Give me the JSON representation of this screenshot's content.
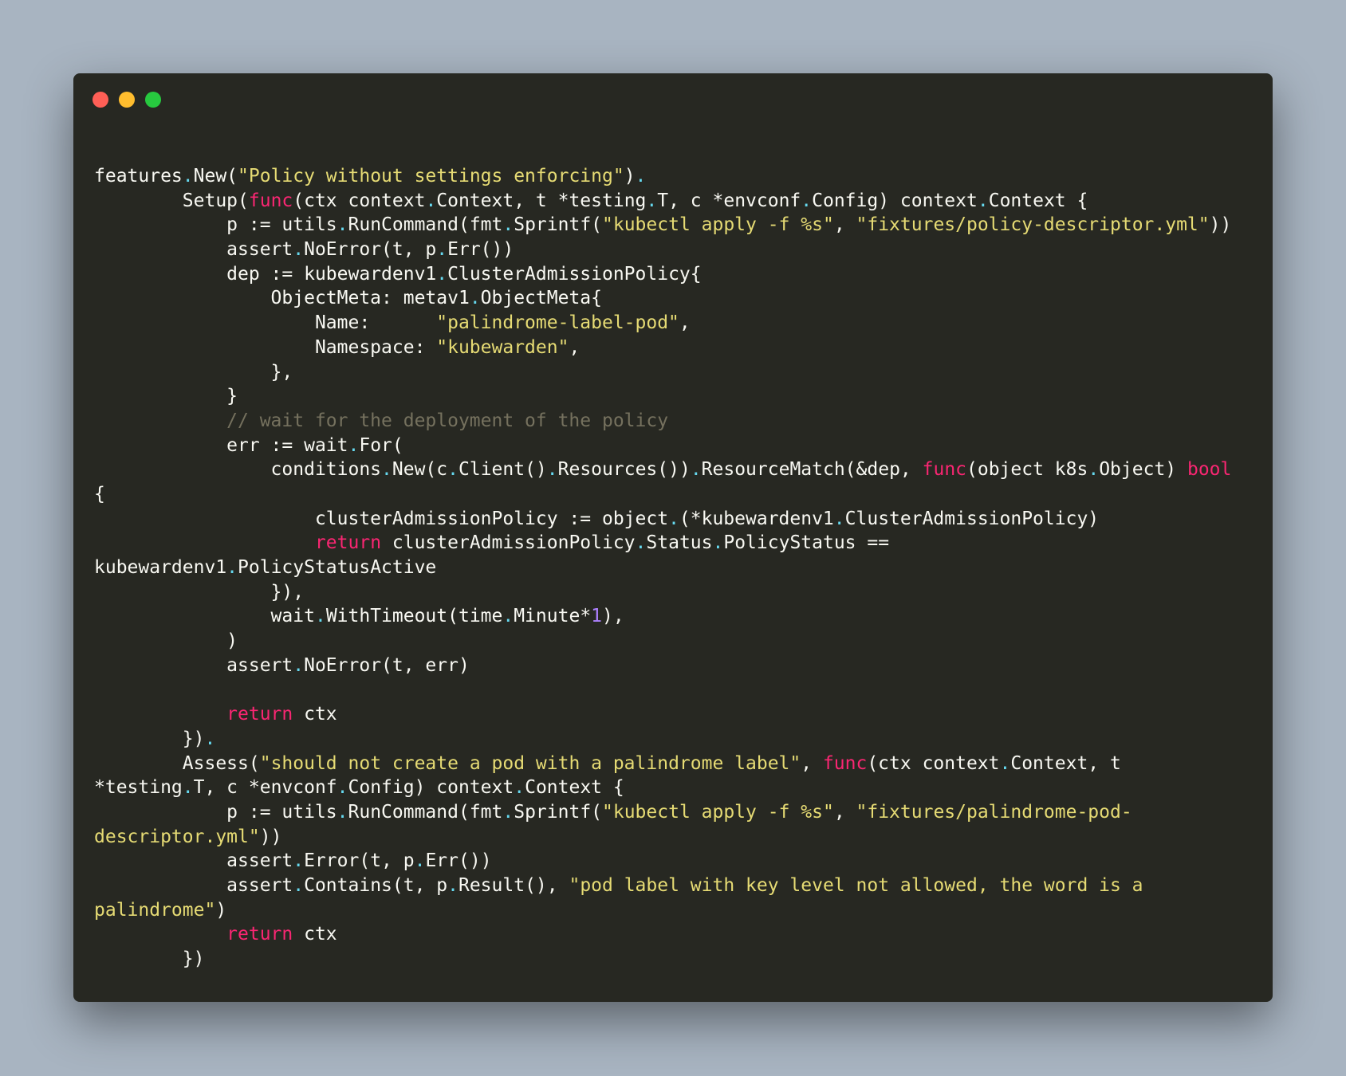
{
  "window": {
    "buttons": [
      "close",
      "minimize",
      "maximize"
    ],
    "colors": {
      "background": "#a8b4c1",
      "editor": "#272822",
      "close": "#ff5f56",
      "minimize": "#ffbd2e",
      "maximize": "#27c93f",
      "plain": "#f8f8f2",
      "punctuation_dot": "#66d9ef",
      "string": "#e6db74",
      "keyword": "#f92672",
      "comment": "#75715e",
      "number": "#ae81ff"
    }
  },
  "code": {
    "lines": [
      [
        [
          "plain",
          "features"
        ],
        [
          "dot",
          "."
        ],
        [
          "plain",
          "New("
        ],
        [
          "str",
          "\"Policy without settings enforcing\""
        ],
        [
          "plain",
          ")"
        ],
        [
          "dot",
          "."
        ]
      ],
      [
        [
          "plain",
          "        Setup("
        ],
        [
          "kw",
          "func"
        ],
        [
          "plain",
          "(ctx context"
        ],
        [
          "dot",
          "."
        ],
        [
          "plain",
          "Context, t *testing"
        ],
        [
          "dot",
          "."
        ],
        [
          "plain",
          "T, c *envconf"
        ],
        [
          "dot",
          "."
        ],
        [
          "plain",
          "Config) context"
        ],
        [
          "dot",
          "."
        ],
        [
          "plain",
          "Context {"
        ]
      ],
      [
        [
          "plain",
          "            p := utils"
        ],
        [
          "dot",
          "."
        ],
        [
          "plain",
          "RunCommand(fmt"
        ],
        [
          "dot",
          "."
        ],
        [
          "plain",
          "Sprintf("
        ],
        [
          "str",
          "\"kubectl apply -f %s\""
        ],
        [
          "plain",
          ", "
        ],
        [
          "str",
          "\"fixtures/policy-descriptor.yml\""
        ],
        [
          "plain",
          "))"
        ]
      ],
      [
        [
          "plain",
          "            assert"
        ],
        [
          "dot",
          "."
        ],
        [
          "plain",
          "NoError(t, p"
        ],
        [
          "dot",
          "."
        ],
        [
          "plain",
          "Err())"
        ]
      ],
      [
        [
          "plain",
          "            dep := kubewardenv1"
        ],
        [
          "dot",
          "."
        ],
        [
          "plain",
          "ClusterAdmissionPolicy{"
        ]
      ],
      [
        [
          "plain",
          "                ObjectMeta: metav1"
        ],
        [
          "dot",
          "."
        ],
        [
          "plain",
          "ObjectMeta{"
        ]
      ],
      [
        [
          "plain",
          "                    Name:      "
        ],
        [
          "str",
          "\"palindrome-label-pod\""
        ],
        [
          "plain",
          ","
        ]
      ],
      [
        [
          "plain",
          "                    Namespace: "
        ],
        [
          "str",
          "\"kubewarden\""
        ],
        [
          "plain",
          ","
        ]
      ],
      [
        [
          "plain",
          "                },"
        ]
      ],
      [
        [
          "plain",
          "            }"
        ]
      ],
      [
        [
          "cmt",
          "            // wait for the deployment of the policy"
        ]
      ],
      [
        [
          "plain",
          "            err := wait"
        ],
        [
          "dot",
          "."
        ],
        [
          "plain",
          "For("
        ]
      ],
      [
        [
          "plain",
          "                conditions"
        ],
        [
          "dot",
          "."
        ],
        [
          "plain",
          "New(c"
        ],
        [
          "dot",
          "."
        ],
        [
          "plain",
          "Client()"
        ],
        [
          "dot",
          "."
        ],
        [
          "plain",
          "Resources())"
        ],
        [
          "dot",
          "."
        ],
        [
          "plain",
          "ResourceMatch(&dep, "
        ],
        [
          "kw",
          "func"
        ],
        [
          "plain",
          "(object k8s"
        ],
        [
          "dot",
          "."
        ],
        [
          "plain",
          "Object) "
        ],
        [
          "kw",
          "bool"
        ]
      ],
      [
        [
          "plain",
          "{"
        ]
      ],
      [
        [
          "plain",
          "                    clusterAdmissionPolicy := object"
        ],
        [
          "dot",
          "."
        ],
        [
          "plain",
          "(*kubewardenv1"
        ],
        [
          "dot",
          "."
        ],
        [
          "plain",
          "ClusterAdmissionPolicy)"
        ]
      ],
      [
        [
          "plain",
          "                    "
        ],
        [
          "kw",
          "return"
        ],
        [
          "plain",
          " clusterAdmissionPolicy"
        ],
        [
          "dot",
          "."
        ],
        [
          "plain",
          "Status"
        ],
        [
          "dot",
          "."
        ],
        [
          "plain",
          "PolicyStatus =="
        ]
      ],
      [
        [
          "plain",
          "kubewardenv1"
        ],
        [
          "dot",
          "."
        ],
        [
          "plain",
          "PolicyStatusActive"
        ]
      ],
      [
        [
          "plain",
          "                }),"
        ]
      ],
      [
        [
          "plain",
          "                wait"
        ],
        [
          "dot",
          "."
        ],
        [
          "plain",
          "WithTimeout(time"
        ],
        [
          "dot",
          "."
        ],
        [
          "plain",
          "Minute*"
        ],
        [
          "num",
          "1"
        ],
        [
          "plain",
          "),"
        ]
      ],
      [
        [
          "plain",
          "            )"
        ]
      ],
      [
        [
          "plain",
          "            assert"
        ],
        [
          "dot",
          "."
        ],
        [
          "plain",
          "NoError(t, err)"
        ]
      ],
      [
        [
          "plain",
          ""
        ]
      ],
      [
        [
          "plain",
          "            "
        ],
        [
          "kw",
          "return"
        ],
        [
          "plain",
          " ctx"
        ]
      ],
      [
        [
          "plain",
          "        })"
        ],
        [
          "dot",
          "."
        ]
      ],
      [
        [
          "plain",
          "        Assess("
        ],
        [
          "str",
          "\"should not create a pod with a palindrome label\""
        ],
        [
          "plain",
          ", "
        ],
        [
          "kw",
          "func"
        ],
        [
          "plain",
          "(ctx context"
        ],
        [
          "dot",
          "."
        ],
        [
          "plain",
          "Context, t"
        ]
      ],
      [
        [
          "plain",
          "*testing"
        ],
        [
          "dot",
          "."
        ],
        [
          "plain",
          "T, c *envconf"
        ],
        [
          "dot",
          "."
        ],
        [
          "plain",
          "Config) context"
        ],
        [
          "dot",
          "."
        ],
        [
          "plain",
          "Context {"
        ]
      ],
      [
        [
          "plain",
          "            p := utils"
        ],
        [
          "dot",
          "."
        ],
        [
          "plain",
          "RunCommand(fmt"
        ],
        [
          "dot",
          "."
        ],
        [
          "plain",
          "Sprintf("
        ],
        [
          "str",
          "\"kubectl apply -f %s\""
        ],
        [
          "plain",
          ", "
        ],
        [
          "str",
          "\"fixtures/palindrome-pod-"
        ]
      ],
      [
        [
          "str",
          "descriptor.yml\""
        ],
        [
          "plain",
          "))"
        ]
      ],
      [
        [
          "plain",
          "            assert"
        ],
        [
          "dot",
          "."
        ],
        [
          "plain",
          "Error(t, p"
        ],
        [
          "dot",
          "."
        ],
        [
          "plain",
          "Err())"
        ]
      ],
      [
        [
          "plain",
          "            assert"
        ],
        [
          "dot",
          "."
        ],
        [
          "plain",
          "Contains(t, p"
        ],
        [
          "dot",
          "."
        ],
        [
          "plain",
          "Result(), "
        ],
        [
          "str",
          "\"pod label with key level not allowed, the word is a"
        ]
      ],
      [
        [
          "str",
          "palindrome\""
        ],
        [
          "plain",
          ")"
        ]
      ],
      [
        [
          "plain",
          "            "
        ],
        [
          "kw",
          "return"
        ],
        [
          "plain",
          " ctx"
        ]
      ],
      [
        [
          "plain",
          "        })"
        ]
      ]
    ]
  }
}
